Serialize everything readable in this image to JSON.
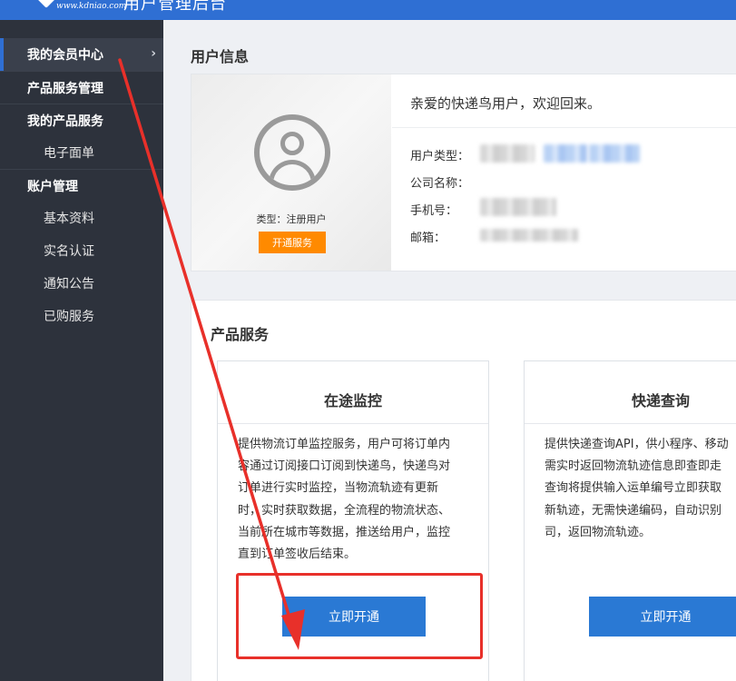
{
  "header": {
    "logo_url": "www.kdniao.com",
    "title": "用户管理后台"
  },
  "sidebar": {
    "items": [
      {
        "label": "我的会员中心",
        "chevron": "›"
      },
      {
        "label": "产品服务管理"
      },
      {
        "label": "我的产品服务"
      },
      {
        "label": "电子面单"
      },
      {
        "label": "账户管理"
      },
      {
        "label": "基本资料"
      },
      {
        "label": "实名认证"
      },
      {
        "label": "通知公告"
      },
      {
        "label": "已购服务"
      }
    ]
  },
  "user_info": {
    "section_title": "用户信息",
    "welcome": "亲爱的快递鸟用户，欢迎回来。",
    "type_label": "类型：注册用户",
    "open_service_button": "开通服务",
    "fields": {
      "user_type": "用户类型：",
      "company": "公司名称：",
      "phone": "手机号：",
      "email": "邮箱："
    }
  },
  "products": {
    "section_title": "产品服务",
    "cards": [
      {
        "title": "在途监控",
        "description": "提供物流订单监控服务，用户可将订单内\n容通过订阅接口订阅到快递鸟，快递鸟对\n订单进行实时监控，当物流轨迹有更新\n时，实时获取数据，全流程的物流状态、\n当前所在城市等数据，推送给用户，监控\n直到订单签收后结束。",
        "button": "立即开通"
      },
      {
        "title": "快递查询",
        "description": "提供快递查询API，供小程序、移动\n需实时返回物流轨迹信息即查即走\n查询将提供输入运单编号立即获取\n新轨迹，无需快递编码，自动识别\n司，返回物流轨迹。",
        "button": "立即开通"
      }
    ]
  },
  "colors": {
    "header_blue": "#2f6fd3",
    "sidebar_bg": "#2d323c",
    "orange_button": "#ff8a00",
    "primary_button": "#2a79d4",
    "annotation_red": "#e8302a"
  }
}
